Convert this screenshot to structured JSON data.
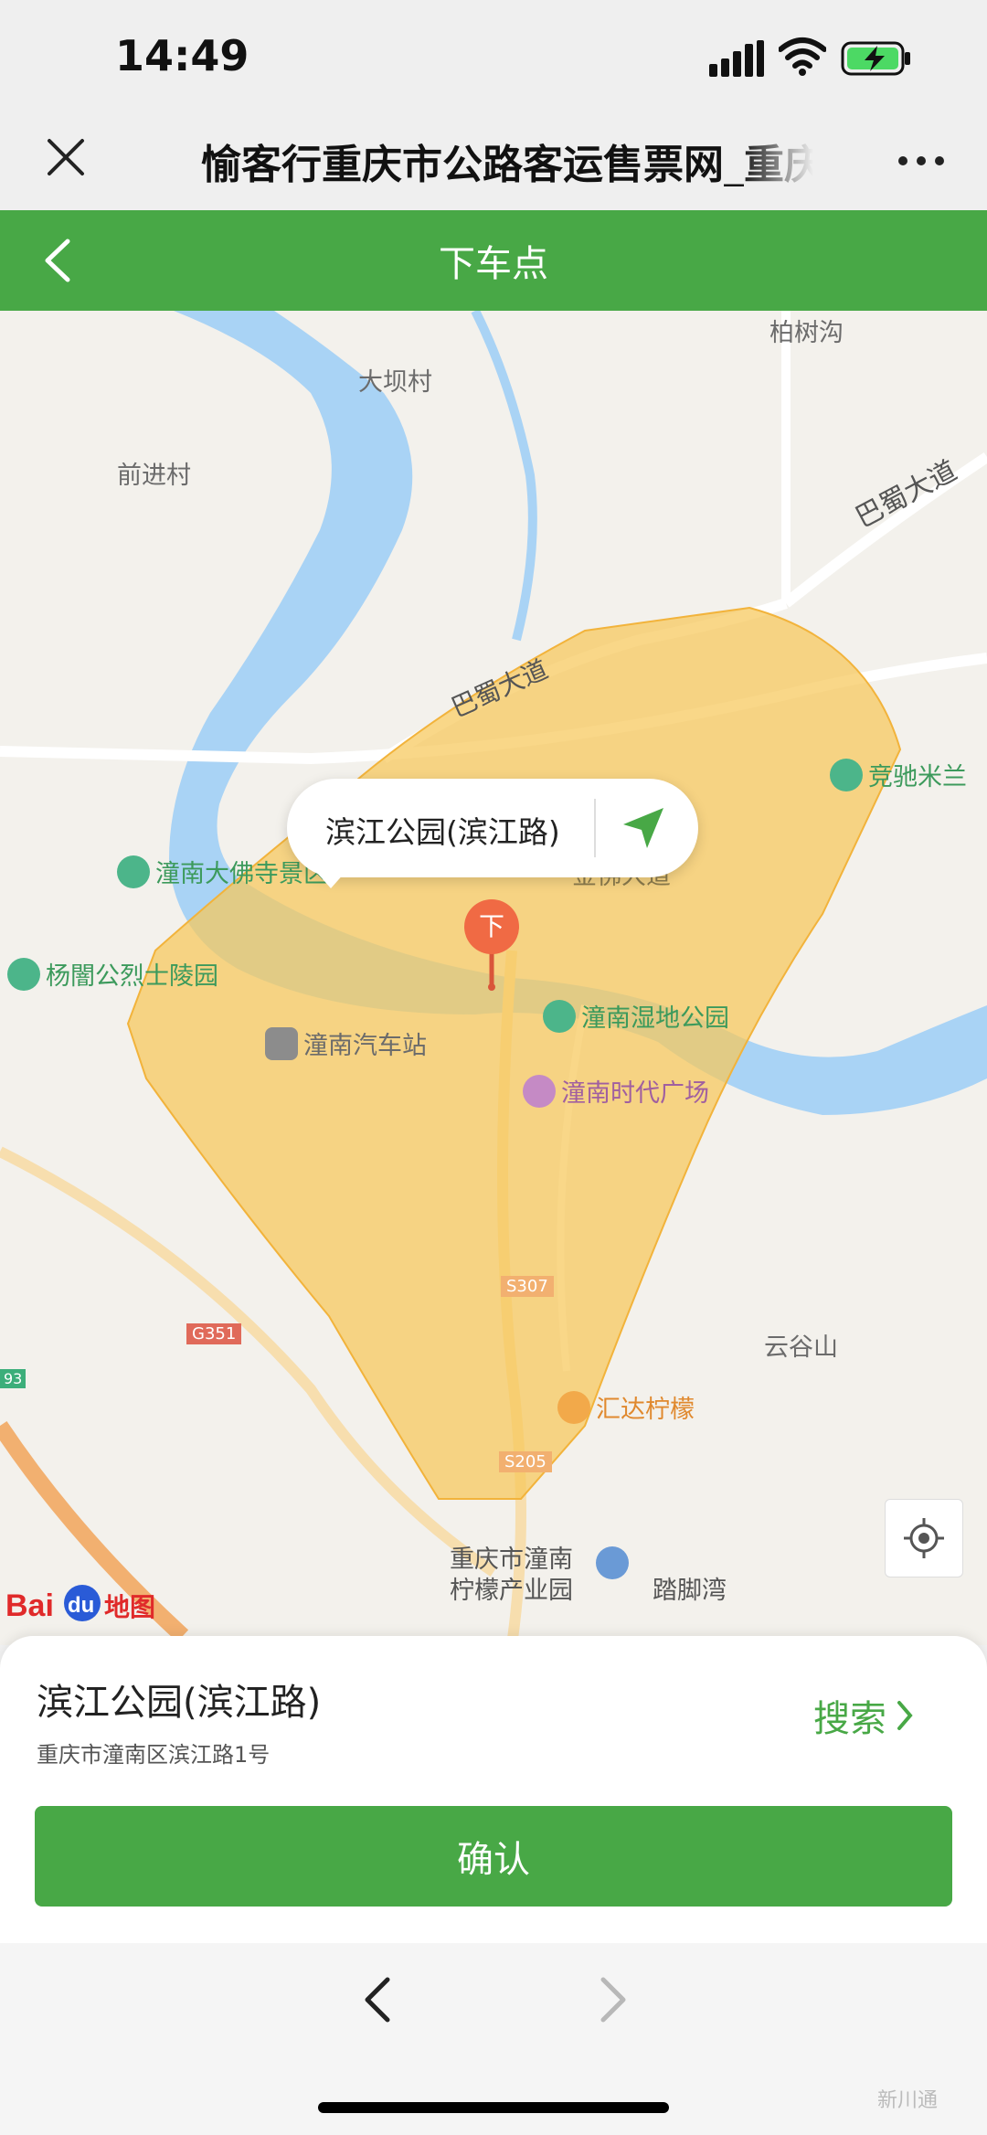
{
  "status_bar": {
    "time": "14:49"
  },
  "titlebar": {
    "title": "愉客行重庆市公路客运售票网_重庆"
  },
  "header": {
    "title": "下车点"
  },
  "map": {
    "labels": {
      "bashu_top": "柏树沟",
      "daba": "大坝村",
      "qianjin": "前进村",
      "bashu_road_right": "巴蜀大道",
      "bashu_road_mid": "巴蜀大道",
      "jingchi": "竞驰米兰",
      "dafo": "潼南大佛寺景区",
      "jinfo_road": "金佛大道",
      "yangyan": "杨闇公烈士陵园",
      "wetland": "潼南湿地公园",
      "bus_station": "潼南汽车站",
      "times_square": "潼南时代广场",
      "s307": "S307",
      "g351": "G351",
      "yungu": "云谷山",
      "huida": "汇达柠檬",
      "s205": "S205",
      "lemon_park_1": "重庆市潼南",
      "lemon_park_2": "柠檬产业园",
      "lujiaowan": "踏脚湾",
      "g93": "93",
      "pin_char": "下"
    },
    "callout": "滨江公园(滨江路)",
    "logo": "Bai du 地图"
  },
  "sheet": {
    "place_name": "滨江公园(滨江路)",
    "address": "重庆市潼南区滨江路1号",
    "search": "搜索",
    "confirm": "确认"
  },
  "watermark": "新川通",
  "colors": {
    "accent": "#48a846",
    "pin": "#f06a44",
    "area": "#f7c85a"
  }
}
